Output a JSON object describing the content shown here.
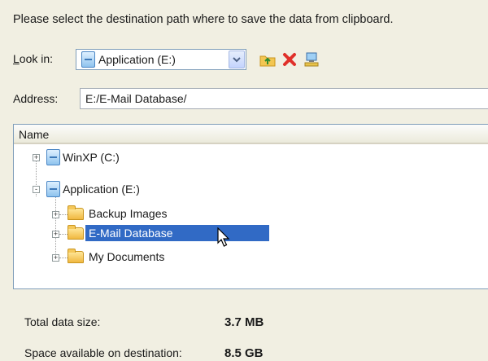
{
  "instruction": "Please select the destination path where to save the data from clipboard.",
  "look_in": {
    "label_ul": "L",
    "label_rest": "ook in:",
    "value": "Application (E:)"
  },
  "toolbar": {
    "up_icon": "up-folder-icon",
    "delete_icon": "delete-icon",
    "network_icon": "network-icon"
  },
  "address": {
    "label": "Address:",
    "value": "E:/E-Mail Database/"
  },
  "tree": {
    "header": "Name",
    "items": [
      {
        "label": "WinXP (C:)",
        "type": "drive",
        "expander": "+"
      },
      {
        "label": "Application (E:)",
        "type": "drive",
        "expander": "-"
      },
      {
        "label": "Backup Images",
        "type": "folder",
        "expander": "+"
      },
      {
        "label": "E-Mail Database",
        "type": "folder",
        "expander": "+",
        "selected": true
      },
      {
        "label": "My Documents",
        "type": "folder",
        "expander": "+"
      }
    ]
  },
  "info": {
    "total_label": "Total data size:",
    "total_value": "3.7 MB",
    "space_label": "Space available on destination:",
    "space_value": "8.5 GB"
  },
  "colors": {
    "background": "#f1efe2",
    "selection": "#316ac5",
    "border": "#7f9db9"
  }
}
